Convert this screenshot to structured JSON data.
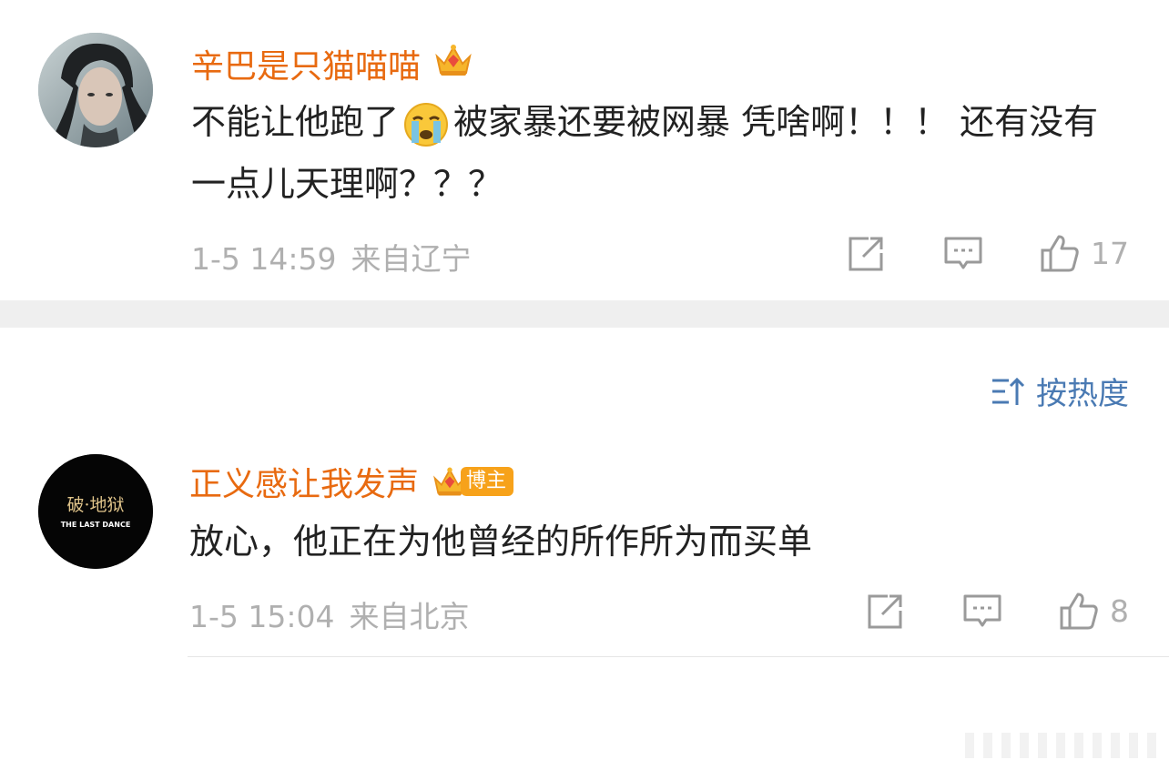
{
  "comments": [
    {
      "username": "辛巴是只猫喵喵",
      "text_before_emoji": "不能让他跑了",
      "text_after_emoji": "被家暴还要被网暴 凭啥啊！！！ 还有没有一点儿天理啊？？？",
      "date": "1-5 14:59",
      "location": "来自辽宁",
      "likes": "17",
      "emoji": "crying-face"
    },
    {
      "username": "正义感让我发声",
      "badge": "博主",
      "text": "放心，他正在为他曾经的所作所为而买单",
      "date": "1-5 15:04",
      "location": "来自北京",
      "likes": "8",
      "avatar_title": "破·地狱",
      "avatar_subtitle": "THE LAST DANCE"
    }
  ],
  "sort": {
    "label": "按热度"
  },
  "colors": {
    "username": "#e86a10",
    "sort": "#4a7ab3",
    "meta": "#b0b0b0",
    "divider": "#efefef"
  }
}
